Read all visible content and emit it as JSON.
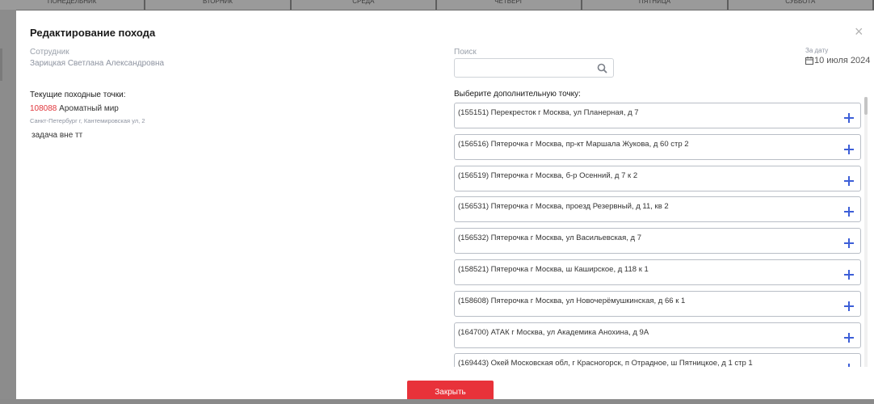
{
  "background": {
    "days": [
      "ПОНЕДЕЛЬНИК",
      "ВТОРНИК",
      "СРЕДА",
      "ЧЕТВЕРГ",
      "ПЯТНИЦА",
      "СУББОТА"
    ]
  },
  "modal": {
    "title": "Редактирование похода",
    "close_icon": "×",
    "employee": {
      "label": "Сотрудник",
      "value": "Зарицкая Светлана Александровна"
    },
    "search": {
      "label": "Поиск",
      "value": "",
      "placeholder": ""
    },
    "date": {
      "label": "За дату",
      "value": "10 июля 2024"
    },
    "current_points": {
      "title": "Текущие походные точки:",
      "items": [
        {
          "code": "108088",
          "name": "Ароматный мир",
          "address": "Санкт-Петербург г, Кантемировская ул, 2"
        }
      ],
      "task": "задача вне тт"
    },
    "select_point": {
      "title": "Выберите дополнительную точку:",
      "items": [
        "(155151) Перекресток г Москва, ул Планерная, д 7",
        "(156516) Пятерочка г Москва, пр-кт Маршала Жукова, д 60 стр 2",
        "(156519) Пятерочка г Москва, б-р Осенний, д 7 к 2",
        "(156531) Пятерочка г Москва, проезд Резервный, д 11, кв 2",
        "(156532) Пятерочка г Москва, ул Васильевская, д 7",
        "(158521) Пятерочка г Москва, ш Каширское, д 118 к 1",
        "(158608) Пятерочка г Москва, ул Новочерёмушкинская, д 66 к 1",
        "(164700) АТАК г Москва, ул Академика Анохина, д 9А",
        "(169443) Окей Московская обл, г Красногорск, п Отрадное, ш Пятницкое, д 1 стр 1"
      ]
    },
    "close_button": "Закрыть"
  },
  "colors": {
    "accent_blue": "#3d5fd8",
    "accent_red": "#e8323a",
    "code_red": "#e0353b"
  },
  "icons": {
    "search": "search-icon",
    "calendar": "calendar-icon",
    "close": "close-icon",
    "add": "plus-icon"
  }
}
